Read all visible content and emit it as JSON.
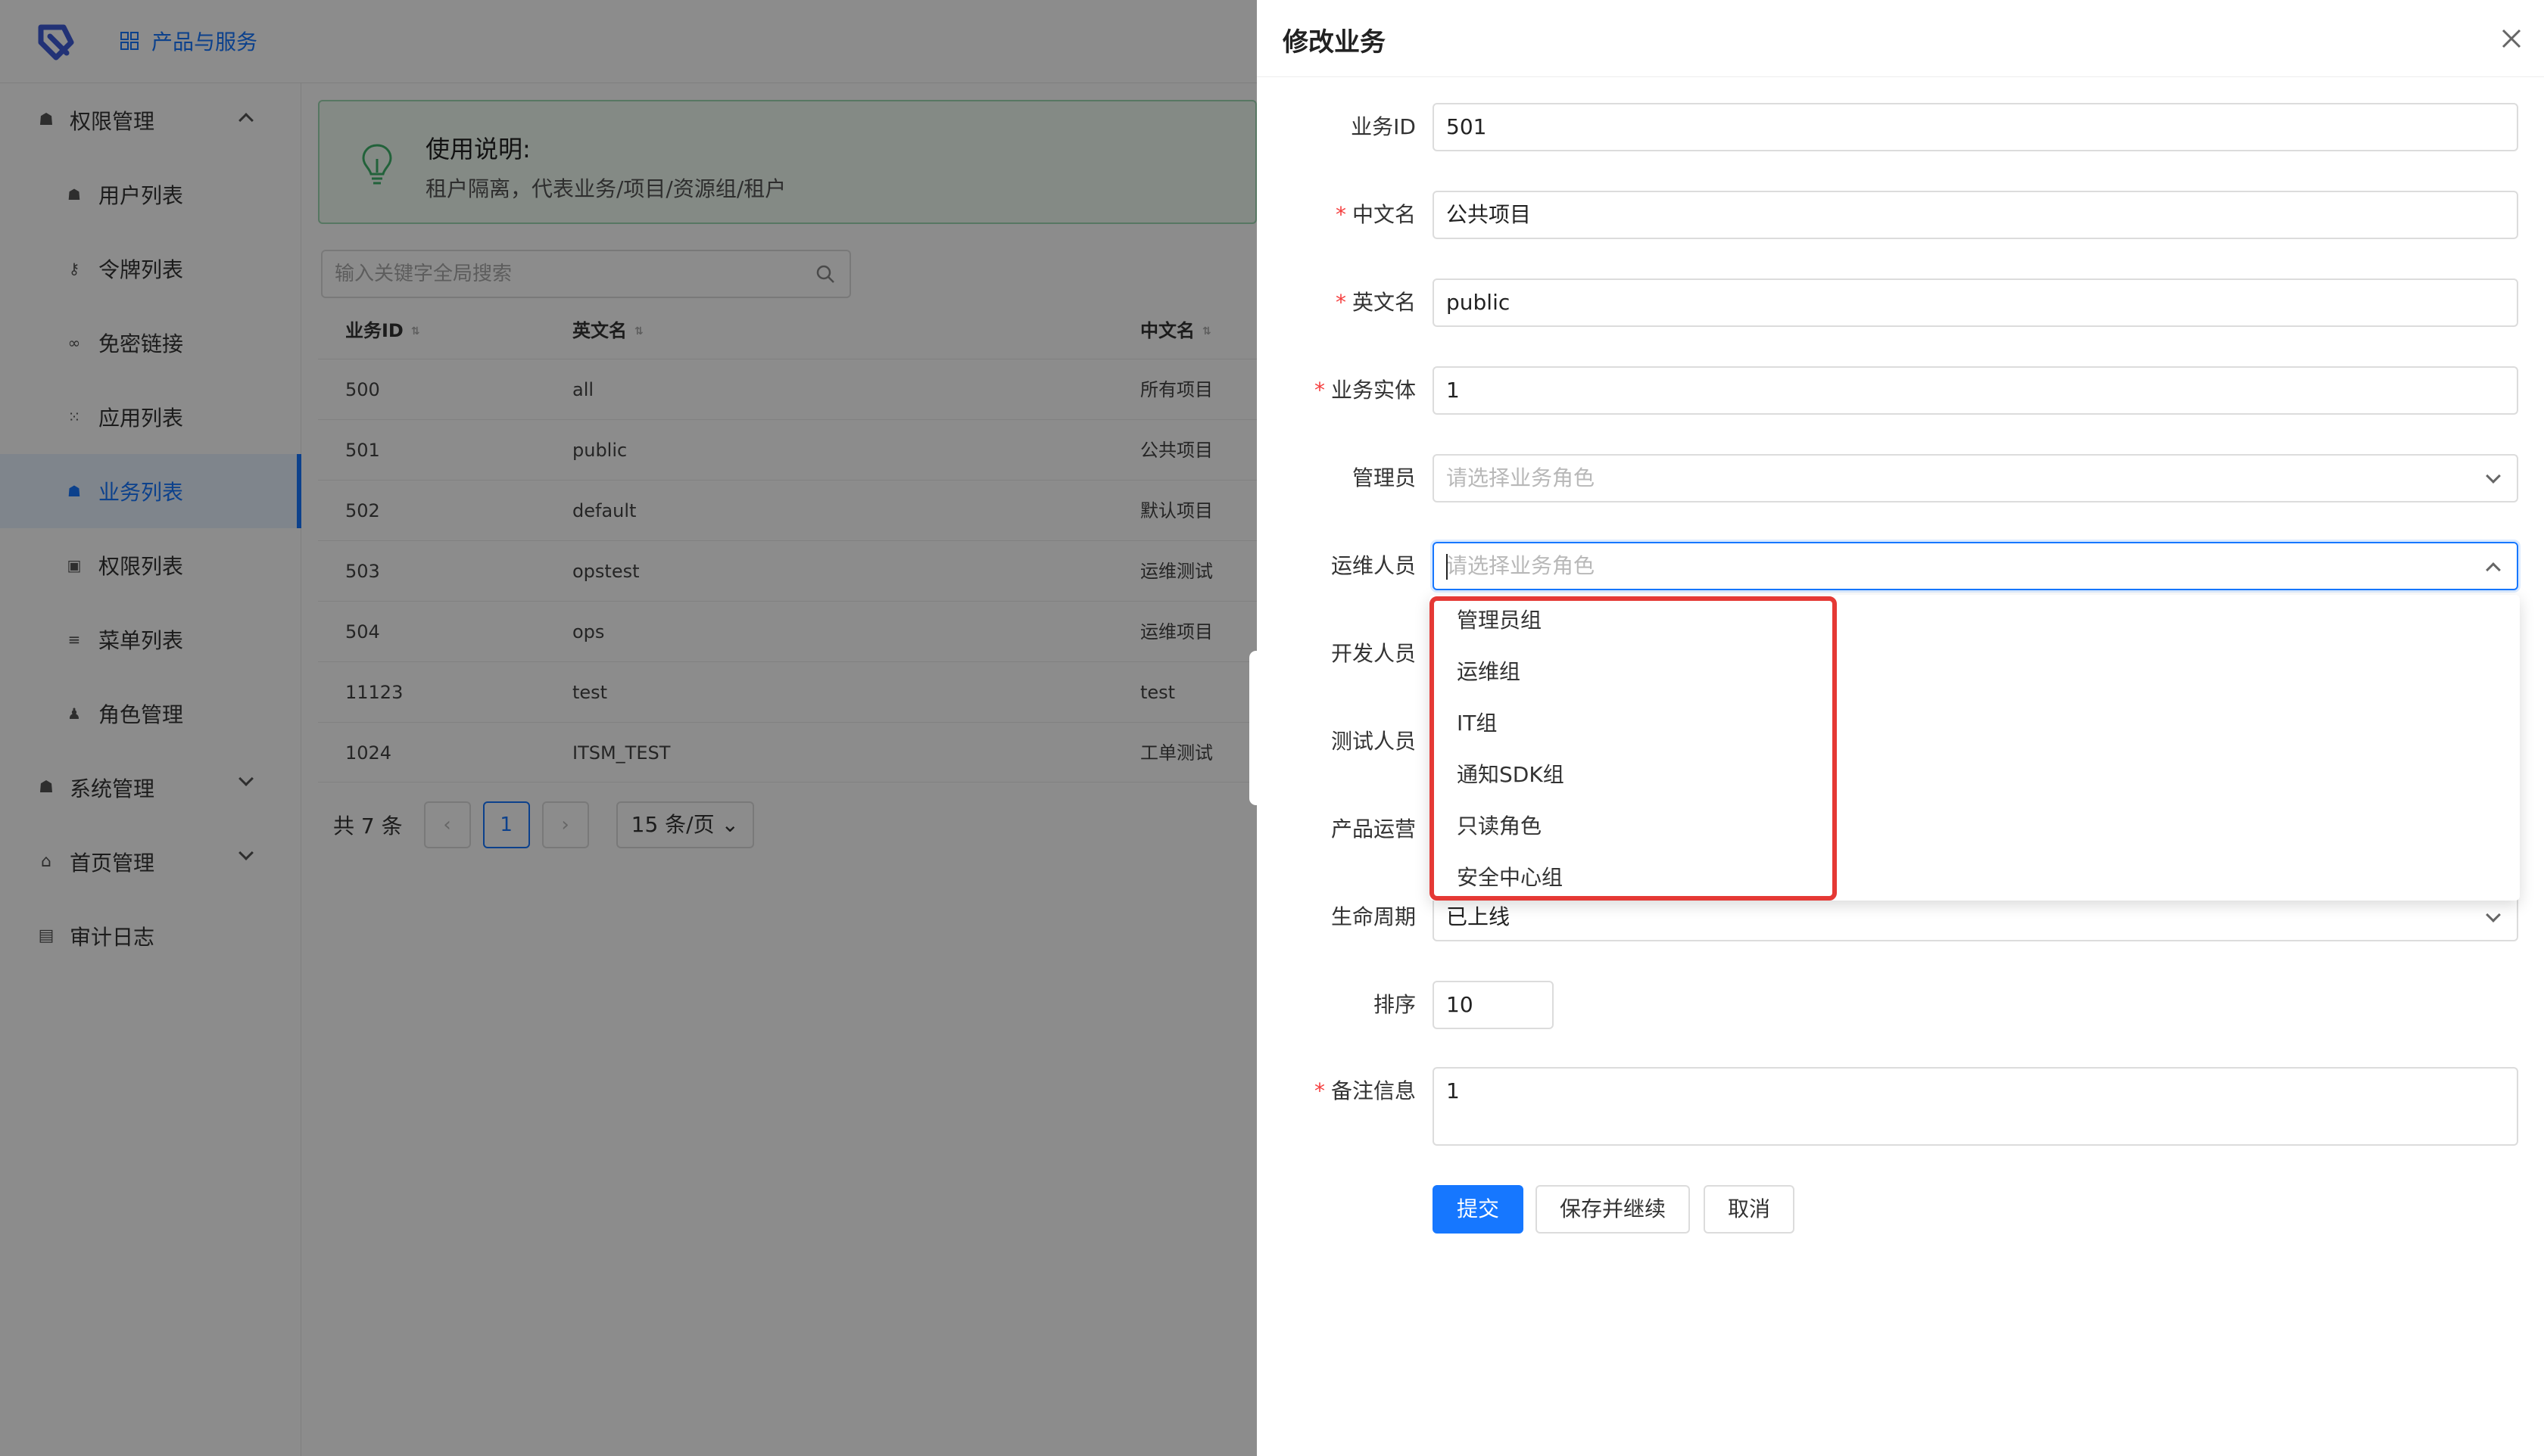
{
  "topbar": {
    "products_label": "产品与服务"
  },
  "sidebar": {
    "groups": [
      {
        "label": "权限管理",
        "icon": "users-icon",
        "expanded": true
      },
      {
        "label": "系统管理",
        "icon": "users-icon",
        "expanded": false
      },
      {
        "label": "首页管理",
        "icon": "home-icon",
        "expanded": false
      },
      {
        "label": "审计日志",
        "icon": "log-icon"
      }
    ],
    "items": [
      {
        "label": "用户列表",
        "icon": "users-icon"
      },
      {
        "label": "令牌列表",
        "icon": "key-icon"
      },
      {
        "label": "免密链接",
        "icon": "link-icon"
      },
      {
        "label": "应用列表",
        "icon": "apps-icon"
      },
      {
        "label": "业务列表",
        "icon": "business-icon",
        "active": true
      },
      {
        "label": "权限列表",
        "icon": "lock-icon"
      },
      {
        "label": "菜单列表",
        "icon": "menu-icon"
      },
      {
        "label": "角色管理",
        "icon": "user-icon"
      }
    ]
  },
  "notice": {
    "title": "使用说明:",
    "text": "租户隔离，代表业务/项目/资源组/租户"
  },
  "search": {
    "placeholder": "输入关键字全局搜索"
  },
  "table": {
    "headers": [
      "业务ID",
      "英文名",
      "中文名"
    ],
    "rows": [
      [
        "500",
        "all",
        "所有项目"
      ],
      [
        "501",
        "public",
        "公共项目"
      ],
      [
        "502",
        "default",
        "默认项目"
      ],
      [
        "503",
        "opstest",
        "运维测试"
      ],
      [
        "504",
        "ops",
        "运维项目"
      ],
      [
        "11123",
        "test",
        "test"
      ],
      [
        "1024",
        "ITSM_TEST",
        "工单测试"
      ]
    ]
  },
  "pager": {
    "total": "共 7 条",
    "prev": "‹",
    "page": "1",
    "next": "›",
    "size": "15 条/页"
  },
  "drawer": {
    "title": "修改业务",
    "fields": {
      "id": {
        "label": "业务ID",
        "value": "501"
      },
      "cn_name": {
        "label": "中文名",
        "value": "公共项目"
      },
      "en_name": {
        "label": "英文名",
        "value": "public"
      },
      "entity": {
        "label": "业务实体",
        "value": "1"
      },
      "admin": {
        "label": "管理员",
        "placeholder": "请选择业务角色"
      },
      "ops": {
        "label": "运维人员",
        "placeholder": "请选择业务角色"
      },
      "dev": {
        "label": "开发人员"
      },
      "test": {
        "label": "测试人员"
      },
      "product": {
        "label": "产品运营"
      },
      "lifecycle": {
        "label": "生命周期",
        "value": "已上线"
      },
      "order": {
        "label": "排序",
        "value": "10"
      },
      "remark": {
        "label": "备注信息",
        "value": "1"
      }
    },
    "dropdown_options": [
      "管理员组",
      "运维组",
      "IT组",
      "通知SDK组",
      "只读角色",
      "安全中心组"
    ],
    "buttons": {
      "submit": "提交",
      "save_continue": "保存并继续",
      "cancel": "取消"
    }
  },
  "colors": {
    "primary": "#1677ff",
    "required": "#f53f3f",
    "highlight": "#e53935"
  }
}
